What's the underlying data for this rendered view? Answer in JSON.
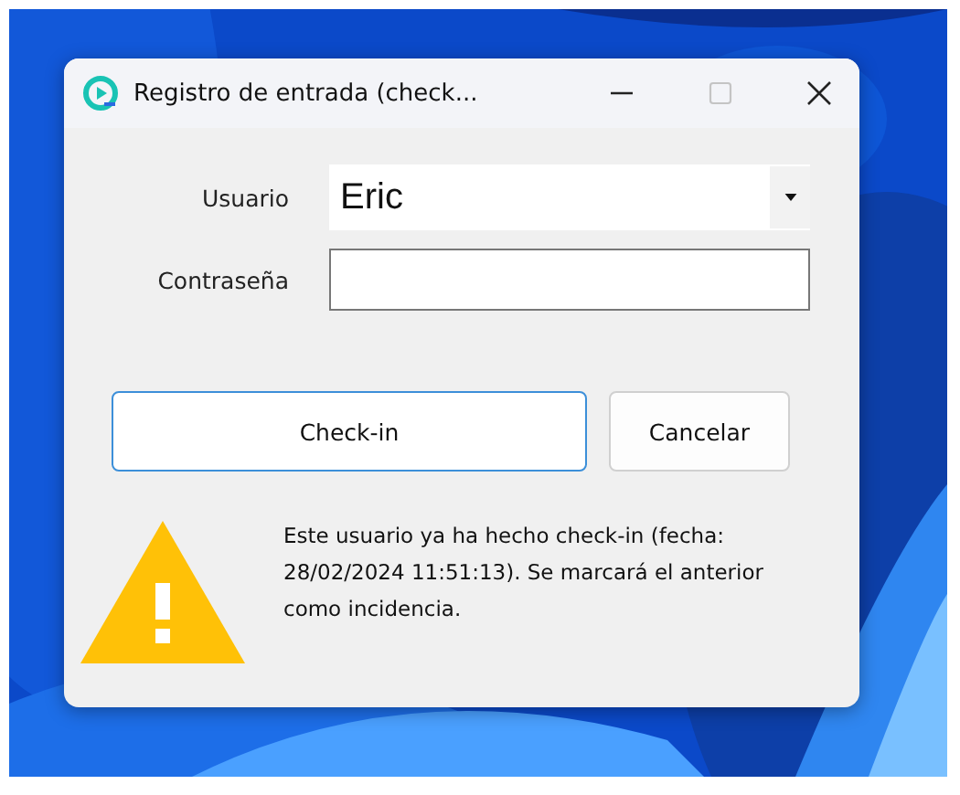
{
  "window": {
    "title": "Registro de entrada (check...",
    "maximize_disabled": true
  },
  "form": {
    "fields": [
      {
        "kind": "combo",
        "label": "Usuario",
        "value": "Eric"
      },
      {
        "kind": "password",
        "label": "Contraseña"
      }
    ]
  },
  "buttons": [
    {
      "label": "Check-in",
      "default": true
    },
    {
      "label": "Cancelar",
      "default": false
    }
  ],
  "message": {
    "kind": "warning",
    "text": "Este usuario ya ha hecho check-in (fecha: 28/02/2024 11:51:13). Se marcará el anterior como incidencia."
  }
}
